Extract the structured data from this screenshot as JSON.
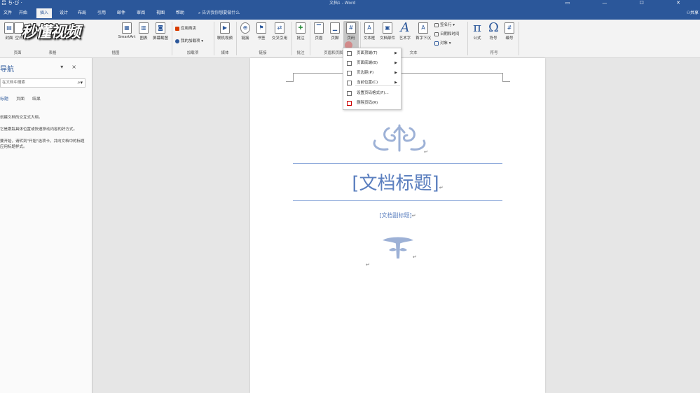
{
  "titlebar": {
    "qat": "吕 ち·び ·",
    "doc_title": "文档1 - Word",
    "window_controls": "▭ — ☐ ✕"
  },
  "tabs": [
    "文件",
    "开始",
    "插入",
    "设计",
    "布局",
    "引用",
    "邮件",
    "审阅",
    "视图",
    "帮助"
  ],
  "active_tab": "插入",
  "tell_me": "告诉我你想要做什么",
  "share": "共享",
  "watermark": "秒懂视频",
  "ribbon": {
    "groups": [
      "页面",
      "表格",
      "插图",
      "加载项",
      "媒体",
      "链接",
      "批注",
      "页眉和页脚",
      "文本",
      "符号"
    ],
    "buttons": {
      "cover": "封面",
      "blank": "空白",
      "smartart": "SmartArt",
      "chart": "图表",
      "screenshot": "屏幕截图",
      "store": "应用商店",
      "my_addins": "我的加载项",
      "online_video": "联机视频",
      "link": "链接",
      "bookmark": "书签",
      "cross_ref": "交叉引用",
      "comment": "批注",
      "header": "页眉",
      "footer": "页脚",
      "page_number": "页码",
      "textbox": "文本框",
      "doc_parts": "文档部件",
      "wordart": "艺术字",
      "drop_cap": "首字下沉",
      "signature": "签名行",
      "datetime": "日期和时间",
      "object": "对象",
      "equation": "公式",
      "symbol": "符号",
      "number": "编号"
    }
  },
  "nav": {
    "title": "导航",
    "search_placeholder": "在文档中搜索",
    "tabs": [
      "标题",
      "页面",
      "结果"
    ],
    "lines": [
      "创建文档的交互式大纲。",
      "它是跟踪具体位置或快速移动内容的好方式。",
      "要开始，请转到\"开始\"选项卡，并向文档中的标题应用标题样式。"
    ]
  },
  "document": {
    "title": "[文档标题]",
    "subtitle": "[文档副标题]",
    "para_mark": "↵"
  },
  "menu": {
    "items": [
      {
        "label": "页面顶端(T)",
        "submenu": true
      },
      {
        "label": "页面底端(B)",
        "submenu": true
      },
      {
        "label": "页边距(P)",
        "submenu": true
      },
      {
        "label": "当前位置(C)",
        "submenu": true
      },
      {
        "label": "设置页码格式(F)...",
        "submenu": false
      },
      {
        "label": "删除页码(R)",
        "submenu": false
      }
    ]
  },
  "colors": {
    "ribbon_blue": "#2b579a",
    "doc_accent": "#5b7fbf",
    "rule": "#8eaadb"
  }
}
